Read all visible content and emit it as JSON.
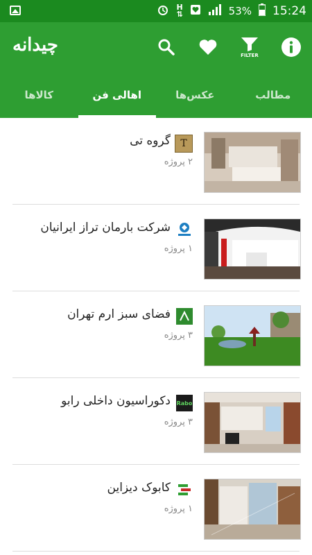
{
  "status_bar": {
    "battery": "53%",
    "time": "15:24"
  },
  "app": {
    "title": "چیدانه",
    "filter_caption": "FILTER"
  },
  "tabs": [
    {
      "label": "مطالب"
    },
    {
      "label": "عکس‌ها"
    },
    {
      "label": "اهالی فن"
    },
    {
      "label": "کالاها"
    }
  ],
  "items": [
    {
      "name": "گروه تی",
      "projects": "۲ پروژه",
      "logo": "T"
    },
    {
      "name": "شرکت بارمان تراز ایرانیان",
      "projects": "۱ پروژه",
      "logo": ""
    },
    {
      "name": "فضای سبز ارم تهران",
      "projects": "۳ پروژه",
      "logo": ""
    },
    {
      "name": "دکوراسیون داخلی رابو",
      "projects": "۳ پروژه",
      "logo": "Rabo"
    },
    {
      "name": "کابوک دیزاین",
      "projects": "۱ پروژه",
      "logo": ""
    }
  ],
  "colors": {
    "primary": "#2e9e32",
    "status": "#1b8a1f"
  }
}
